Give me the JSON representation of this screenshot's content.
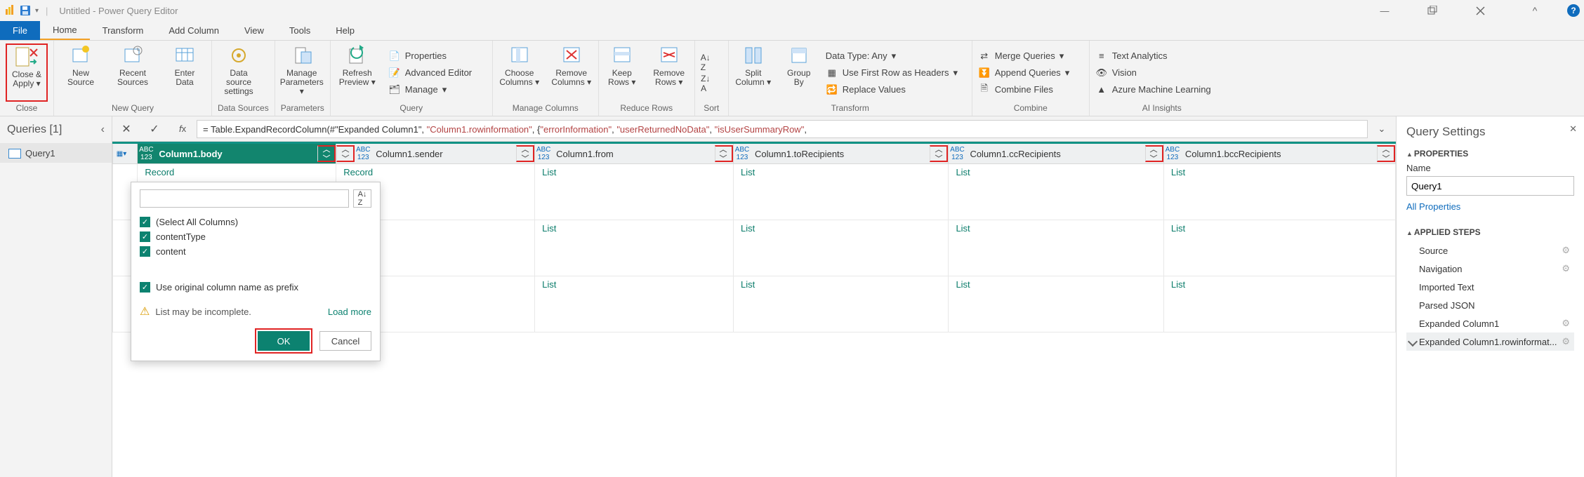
{
  "titlebar": {
    "title": "Untitled - Power Query Editor"
  },
  "tabs": {
    "file": "File",
    "home": "Home",
    "transform": "Transform",
    "addcolumn": "Add Column",
    "view": "View",
    "tools": "Tools",
    "help": "Help"
  },
  "ribbon": {
    "close": {
      "btn": "Close &\nApply",
      "group": "Close"
    },
    "newquery": {
      "new": "New\nSource",
      "recent": "Recent\nSources",
      "enter": "Enter\nData",
      "group": "New Query"
    },
    "datasources": {
      "btn": "Data source\nsettings",
      "group": "Data Sources"
    },
    "parameters": {
      "btn": "Manage\nParameters",
      "group": "Parameters"
    },
    "query": {
      "refresh": "Refresh\nPreview",
      "properties": "Properties",
      "adv": "Advanced Editor",
      "manage": "Manage",
      "group": "Query"
    },
    "managecols": {
      "choose": "Choose\nColumns",
      "remove": "Remove\nColumns",
      "group": "Manage Columns"
    },
    "reducerows": {
      "keep": "Keep\nRows",
      "remove": "Remove\nRows",
      "group": "Reduce Rows"
    },
    "sort": {
      "group": "Sort"
    },
    "transform": {
      "split": "Split\nColumn",
      "group": "Group\nBy",
      "datatype": "Data Type: Any",
      "firstrow": "Use First Row as Headers",
      "replace": "Replace Values",
      "grouplbl": "Transform"
    },
    "combine": {
      "merge": "Merge Queries",
      "append": "Append Queries",
      "combine": "Combine Files",
      "group": "Combine"
    },
    "ai": {
      "text": "Text Analytics",
      "vision": "Vision",
      "aml": "Azure Machine Learning",
      "group": "AI Insights"
    }
  },
  "queries": {
    "header": "Queries [1]",
    "item": "Query1"
  },
  "formula": {
    "pre": "= Table.ExpandRecordColumn(#\"Expanded Column1\", ",
    "s1": "\"Column1.rowinformation\"",
    "mid1": ", {",
    "s2": "\"errorInformation\"",
    "mid2": ", ",
    "s3": "\"userReturnedNoData\"",
    "mid3": ", ",
    "s4": "\"isUserSummaryRow\"",
    "tail": ","
  },
  "grid": {
    "cols": [
      "Column1.body",
      "Column1.sender",
      "Column1.from",
      "Column1.toRecipients",
      "Column1.ccRecipients",
      "Column1.bccRecipients"
    ],
    "row_record": "Record",
    "row_list": "List"
  },
  "popup": {
    "all": "(Select All Columns)",
    "c1": "contentType",
    "c2": "content",
    "prefix": "Use original column name as prefix",
    "warn": "List may be incomplete.",
    "load": "Load more",
    "ok": "OK",
    "cancel": "Cancel"
  },
  "qs": {
    "title": "Query Settings",
    "props": "PROPERTIES",
    "name_lbl": "Name",
    "name_val": "Query1",
    "allprops": "All Properties",
    "steps_lbl": "APPLIED STEPS",
    "steps": [
      "Source",
      "Navigation",
      "Imported Text",
      "Parsed JSON",
      "Expanded Column1",
      "Expanded Column1.rowinformat..."
    ]
  }
}
